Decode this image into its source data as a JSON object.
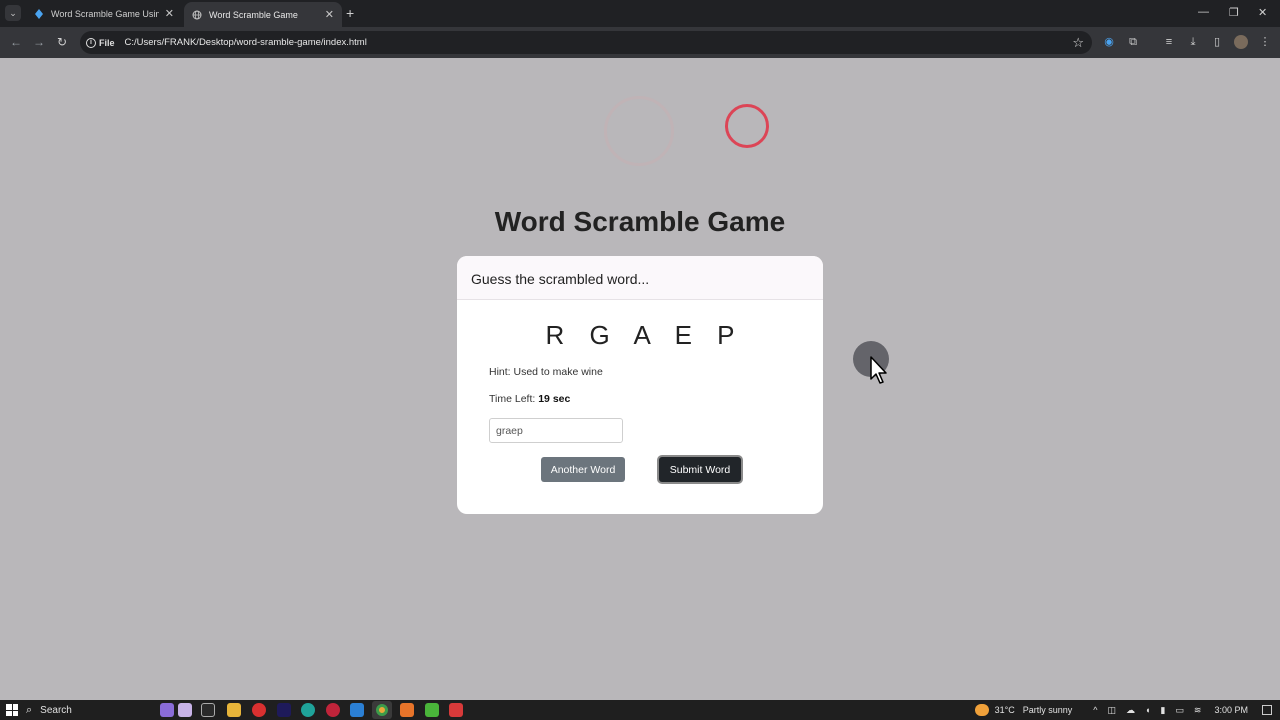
{
  "browser": {
    "tabs": [
      {
        "title": "Word Scramble Game Using HT",
        "active": false
      },
      {
        "title": "Word Scramble Game",
        "active": true
      }
    ],
    "new_tab": "+",
    "address": {
      "scheme_label": "File",
      "url": "C:/Users/FRANK/Desktop/word-sramble-game/index.html"
    },
    "window_controls": {
      "minimize": "—",
      "restore": "❐",
      "close": "✕"
    }
  },
  "page": {
    "title": "Word Scramble Game",
    "card": {
      "header": "Guess the scrambled word...",
      "scrambled_word": "R G A E P",
      "hint_label": "Hint: Used to make wine",
      "time_label": "Time Left: ",
      "time_value": "19 sec",
      "input_value": "graep",
      "another_button": "Another Word",
      "submit_button": "Submit Word"
    }
  },
  "taskbar": {
    "search_label": "Search",
    "weather": "31°C",
    "weather_desc": "Partly sunny",
    "time": "3:00 PM"
  },
  "colors": {
    "accent_ring": "#e0394b",
    "page_bg": "#b9b7ba",
    "primary_btn": "#212529",
    "secondary_btn": "#6c757d"
  }
}
